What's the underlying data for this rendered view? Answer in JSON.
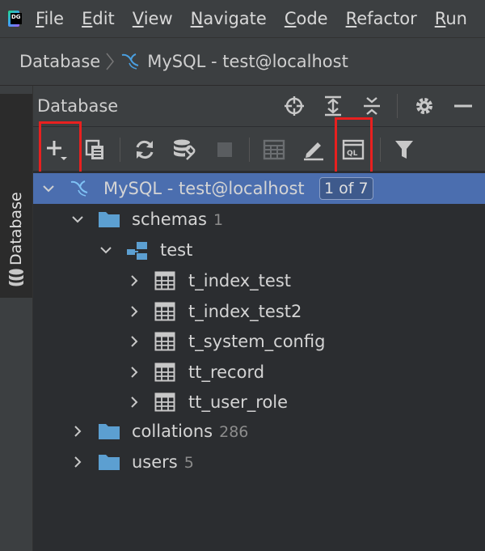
{
  "menu": {
    "logo_text": "DG",
    "items": [
      {
        "pre": "",
        "mnemonic": "F",
        "post": "ile"
      },
      {
        "pre": "",
        "mnemonic": "E",
        "post": "dit"
      },
      {
        "pre": "",
        "mnemonic": "V",
        "post": "iew"
      },
      {
        "pre": "",
        "mnemonic": "N",
        "post": "avigate"
      },
      {
        "pre": "",
        "mnemonic": "C",
        "post": "ode"
      },
      {
        "pre": "",
        "mnemonic": "R",
        "post": "efactor"
      },
      {
        "pre": "",
        "mnemonic": "R",
        "post": "un"
      }
    ]
  },
  "breadcrumb": {
    "root": "Database",
    "current": "MySQL - test@localhost"
  },
  "sidebar": {
    "tab_label": "Database"
  },
  "tool_window": {
    "title": "Database"
  },
  "tree": {
    "datasource": {
      "label": "MySQL - test@localhost",
      "badge": "1 of 7"
    },
    "schemas": {
      "label": "schemas",
      "count": "1"
    },
    "schema": {
      "label": "test"
    },
    "tables": [
      "t_index_test",
      "t_index_test2",
      "t_system_config",
      "tt_record",
      "tt_user_role"
    ],
    "collations": {
      "label": "collations",
      "count": "286"
    },
    "users": {
      "label": "users",
      "count": "5"
    }
  },
  "colors": {
    "selection": "#4b6eaf",
    "highlight_border": "#e8201f",
    "folder": "#5c9fd1",
    "mysql_icon": "#4a9fe0"
  }
}
